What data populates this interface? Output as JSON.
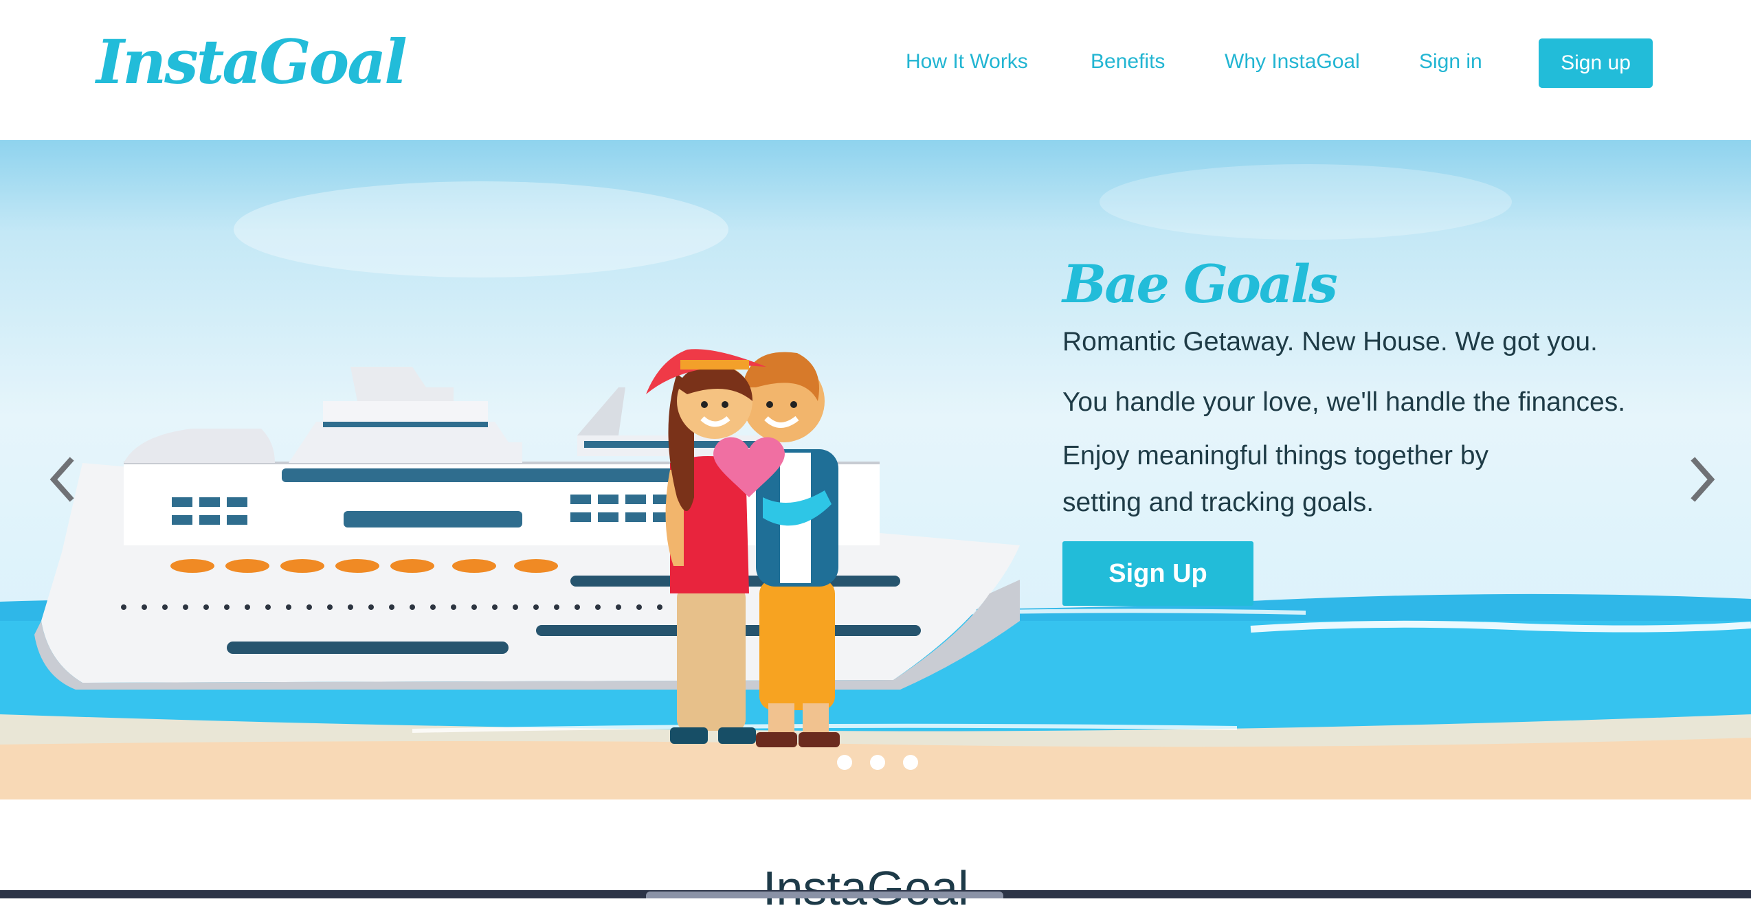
{
  "brand": {
    "logo": "InstaGoal"
  },
  "nav": {
    "links": [
      "How It Works",
      "Benefits",
      "Why InstaGoal",
      "Sign in"
    ],
    "signup_label": "Sign up"
  },
  "hero": {
    "title": "Bae Goals",
    "lines": [
      "Romantic Getaway. New House. We got you.",
      "You handle your love, we'll handle the finances.",
      "Enjoy meaningful things together by",
      "setting and tracking goals."
    ],
    "cta_label": "Sign Up",
    "carousel": {
      "slides": 3,
      "active_index": 0
    }
  },
  "section": {
    "title": "InstaGoal"
  },
  "colors": {
    "accent": "#22bcd9",
    "text_dark": "#1e3b46",
    "sea": "#35c3ef",
    "sand": "#f6d8b6"
  },
  "icons": {
    "prev": "chevron-left-icon",
    "next": "chevron-right-icon"
  }
}
